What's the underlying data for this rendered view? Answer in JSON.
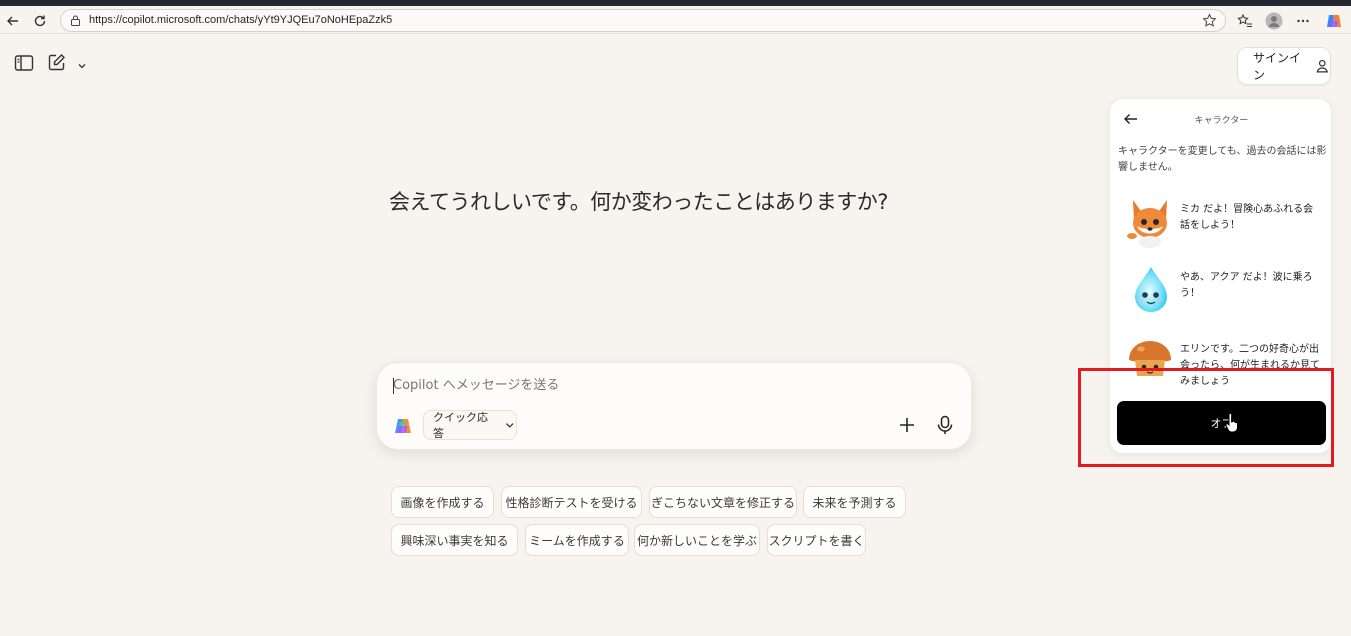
{
  "browser": {
    "url": "https://copilot.microsoft.com/chats/yYt9YJQEu7oNoHEpaZzk5"
  },
  "header": {
    "signin_label": "サインイン"
  },
  "main": {
    "greeting": "会えてうれしいです。何か変わったことはありますか?"
  },
  "composer": {
    "placeholder": "Copilot へメッセージを送る",
    "mode_label": "クイック応答"
  },
  "suggestions": [
    "画像を作成する",
    "性格診断テストを受ける",
    "ぎこちない文章を修正する",
    "未来を予測する",
    "興味深い事実を知る",
    "ミームを作成する",
    "何か新しいことを学ぶ",
    "スクリプトを書く"
  ],
  "panel": {
    "title": "キャラクター",
    "description": "キャラクターを変更しても、過去の会話には影響しません。",
    "characters": [
      {
        "text": "ミカ だよ！冒険心あふれる会話をしよう！",
        "avatar": "fox-icon"
      },
      {
        "text": "やあ、アクア だよ！波に乗ろう！",
        "avatar": "water-drop-icon"
      },
      {
        "text": "エリンです。二つの好奇心が出会ったら、何が生まれるか見てみましょう",
        "avatar": "mushroom-icon"
      }
    ],
    "off_label": "オフ"
  },
  "colors": {
    "background": "#f7f4ef",
    "highlight": "#e01b22",
    "off_button": "#000000"
  }
}
